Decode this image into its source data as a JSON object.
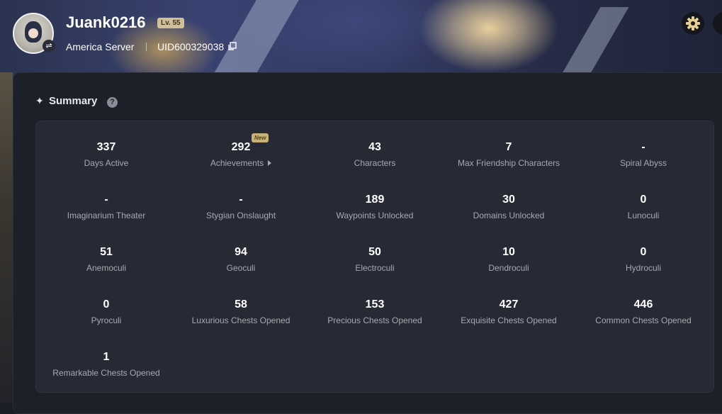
{
  "profile": {
    "username": "Juank0216",
    "level": "Lv. 55",
    "server": "America Server",
    "uid": "UID600329038"
  },
  "summary": {
    "title": "Summary",
    "new_badge": "New",
    "stats": [
      {
        "value": "337",
        "label": "Days Active"
      },
      {
        "value": "292",
        "label": "Achievements"
      },
      {
        "value": "43",
        "label": "Characters"
      },
      {
        "value": "7",
        "label": "Max Friendship Characters"
      },
      {
        "value": "-",
        "label": "Spiral Abyss"
      },
      {
        "value": "-",
        "label": "Imaginarium Theater"
      },
      {
        "value": "-",
        "label": "Stygian Onslaught"
      },
      {
        "value": "189",
        "label": "Waypoints Unlocked"
      },
      {
        "value": "30",
        "label": "Domains Unlocked"
      },
      {
        "value": "0",
        "label": "Lunoculi"
      },
      {
        "value": "51",
        "label": "Anemoculi"
      },
      {
        "value": "94",
        "label": "Geoculi"
      },
      {
        "value": "50",
        "label": "Electroculi"
      },
      {
        "value": "10",
        "label": "Dendroculi"
      },
      {
        "value": "0",
        "label": "Hydroculi"
      },
      {
        "value": "0",
        "label": "Pyroculi"
      },
      {
        "value": "58",
        "label": "Luxurious Chests Opened"
      },
      {
        "value": "153",
        "label": "Precious Chests Opened"
      },
      {
        "value": "427",
        "label": "Exquisite Chests Opened"
      },
      {
        "value": "446",
        "label": "Common Chests Opened"
      },
      {
        "value": "1",
        "label": "Remarkable Chests Opened"
      }
    ]
  }
}
